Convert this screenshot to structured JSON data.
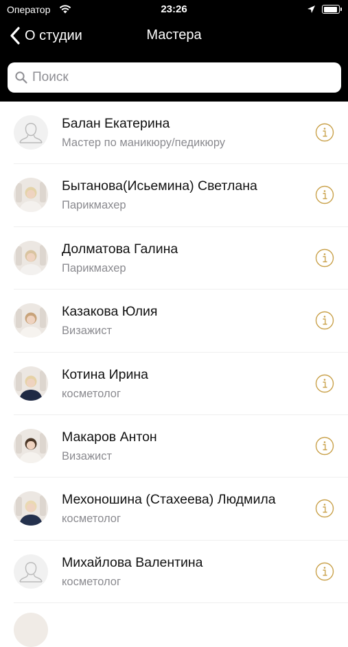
{
  "status_bar": {
    "carrier": "Оператор",
    "time": "23:26",
    "battery_level": 0.95
  },
  "nav": {
    "back_label": "О студии",
    "title": "Мастера"
  },
  "search": {
    "placeholder": "Поиск",
    "value": ""
  },
  "masters": [
    {
      "name": "Балан Екатерина",
      "role": "Мастер по маникюру/педикюру",
      "avatar": "placeholder"
    },
    {
      "name": "Бытанова(Исьемина) Светлана",
      "role": "Парикмахер",
      "avatar": "photo",
      "coat": "#f4f1ee",
      "hair": "#e4d3a8"
    },
    {
      "name": "Долматова Галина",
      "role": "Парикмахер",
      "avatar": "photo",
      "coat": "#f3f1ef",
      "hair": "#d9c4a0"
    },
    {
      "name": "Казакова Юлия",
      "role": "Визажист",
      "avatar": "photo",
      "coat": "#f6f3ef",
      "hair": "#c8a37a"
    },
    {
      "name": "Котина Ирина",
      "role": "косметолог",
      "avatar": "photo",
      "coat": "#1f2a44",
      "hair": "#e6d2a6"
    },
    {
      "name": "Макаров Антон",
      "role": "Визажист",
      "avatar": "photo",
      "coat": "#f5f2ee",
      "hair": "#4a3626"
    },
    {
      "name": "Мехоношина (Стахеева) Людмила",
      "role": "косметолог",
      "avatar": "photo",
      "coat": "#24314d",
      "hair": "#ead9b2"
    },
    {
      "name": "Михайлова Валентина",
      "role": "косметолог",
      "avatar": "placeholder"
    }
  ],
  "colors": {
    "accent": "#c9a14a",
    "nav_background": "#000000"
  }
}
